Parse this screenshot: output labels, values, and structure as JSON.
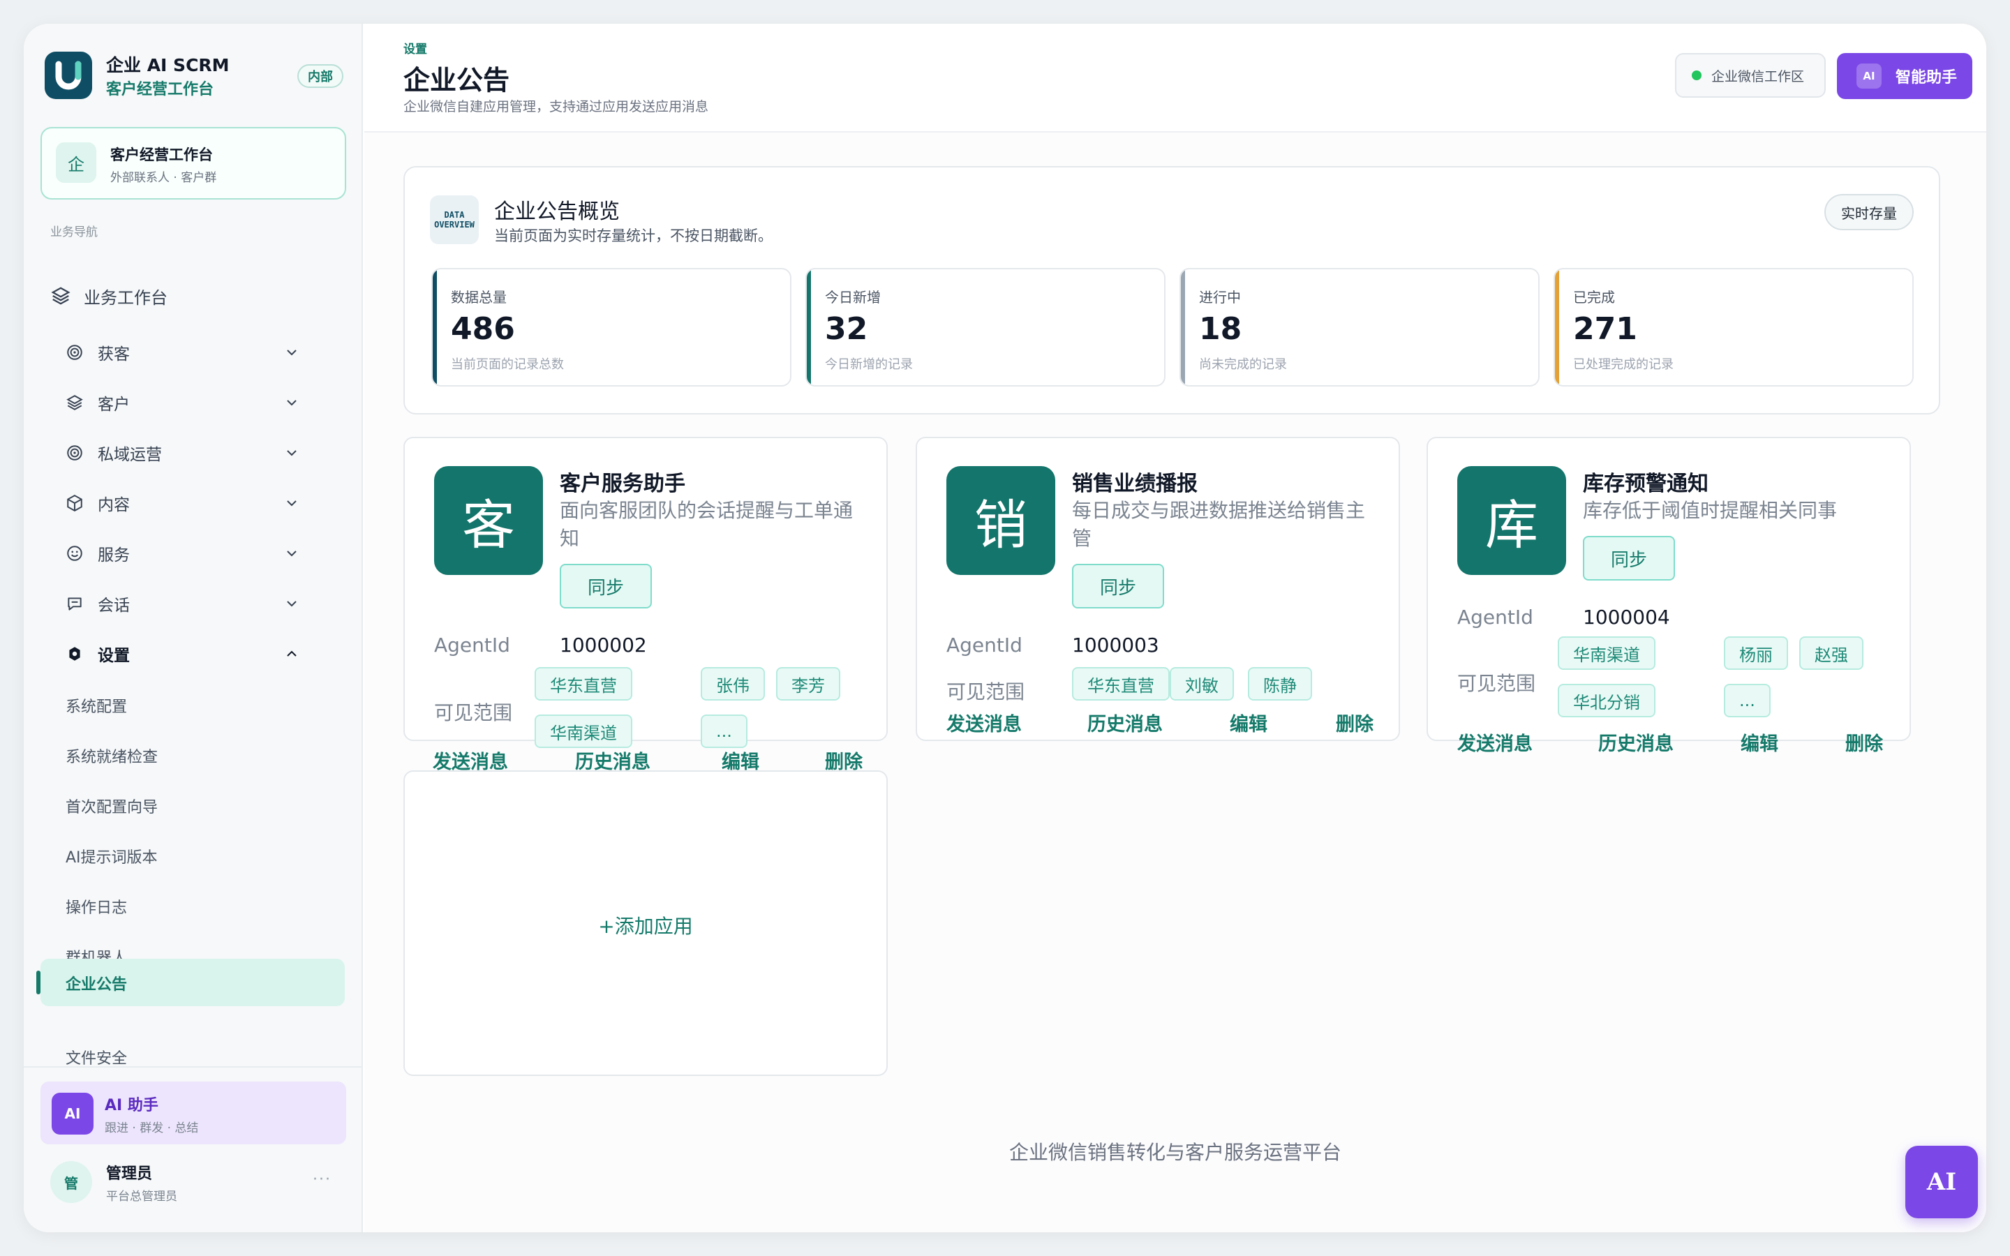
{
  "brand": {
    "title": "企业 AI SCRM",
    "subtitle": "客户经营工作台",
    "badge": "内部",
    "logo_letter": "U"
  },
  "workspace": {
    "icon": "企",
    "title": "客户经营工作台",
    "subtitle": "外部联系人 · 客户群"
  },
  "nav": {
    "section_label": "业务导航",
    "top_item": "业务工作台",
    "groups": [
      {
        "label": "获客",
        "icon": "target-icon",
        "expanded": false
      },
      {
        "label": "客户",
        "icon": "layers-icon",
        "expanded": false
      },
      {
        "label": "私域运营",
        "icon": "target-icon",
        "expanded": false
      },
      {
        "label": "内容",
        "icon": "box-icon",
        "expanded": false
      },
      {
        "label": "服务",
        "icon": "smile-icon",
        "expanded": false
      },
      {
        "label": "会话",
        "icon": "chat-icon",
        "expanded": false
      },
      {
        "label": "设置",
        "icon": "settings-icon",
        "expanded": true
      }
    ],
    "settings_items": [
      "系统配置",
      "系统就绪检查",
      "首次配置向导",
      "AI提示词版本",
      "操作日志",
      "群机器人",
      "企业公告",
      "文件安全"
    ],
    "active_item": "企业公告"
  },
  "ai_helper": {
    "icon": "AI",
    "title": "AI 助手",
    "subtitle": "跟进 · 群发 · 总结"
  },
  "user": {
    "avatar": "管",
    "name": "管理员",
    "role": "平台总管理员",
    "more": "···"
  },
  "header": {
    "breadcrumb": "设置",
    "title": "企业公告",
    "description": "企业微信自建应用管理，支持通过应用发送应用消息",
    "workspace_btn": "企业微信工作区",
    "ai_btn_chip": "AI",
    "ai_btn": "智能助手"
  },
  "overview": {
    "icon_line1": "DATA",
    "icon_line2": "OVERVIEW",
    "title": "企业公告概览",
    "subtitle": "当前页面为实时存量统计，不按日期截断。",
    "realtime_btn": "实时存量",
    "stats": [
      {
        "label": "数据总量",
        "value": "486",
        "sub": "当前页面的记录总数",
        "color": "#0e4d64"
      },
      {
        "label": "今日新增",
        "value": "32",
        "sub": "今日新增的记录",
        "color": "#13756b"
      },
      {
        "label": "进行中",
        "value": "18",
        "sub": "尚未完成的记录",
        "color": "#9aa6b2"
      },
      {
        "label": "已完成",
        "value": "271",
        "sub": "已处理完成的记录",
        "color": "#e3a136"
      }
    ]
  },
  "apps": [
    {
      "icon": "客",
      "name": "客户服务助手",
      "desc": "面向客服团队的会话提醒与工单通知",
      "sync": "同步",
      "agent_label": "AgentId",
      "agent_id": "1000002",
      "scope_label": "可见范围",
      "tags": [
        "华东直营",
        "张伟",
        "李芳",
        "华南渠道",
        "..."
      ],
      "actions": [
        "发送消息",
        "历史消息",
        "编辑",
        "删除"
      ]
    },
    {
      "icon": "销",
      "name": "销售业绩播报",
      "desc": "每日成交与跟进数据推送给销售主管",
      "sync": "同步",
      "agent_label": "AgentId",
      "agent_id": "1000003",
      "scope_label": "可见范围",
      "tags": [
        "华东直营",
        "刘敏",
        "陈静"
      ],
      "actions": [
        "发送消息",
        "历史消息",
        "编辑",
        "删除"
      ]
    },
    {
      "icon": "库",
      "name": "库存预警通知",
      "desc": "库存低于阈值时提醒相关同事",
      "sync": "同步",
      "agent_label": "AgentId",
      "agent_id": "1000004",
      "scope_label": "可见范围",
      "tags": [
        "华南渠道",
        "杨丽",
        "赵强",
        "华北分销",
        "..."
      ],
      "actions": [
        "发送消息",
        "历史消息",
        "编辑",
        "删除"
      ]
    }
  ],
  "add_app": "+添加应用",
  "footer": "企业微信销售转化与客户服务运营平台",
  "fab": "AI"
}
